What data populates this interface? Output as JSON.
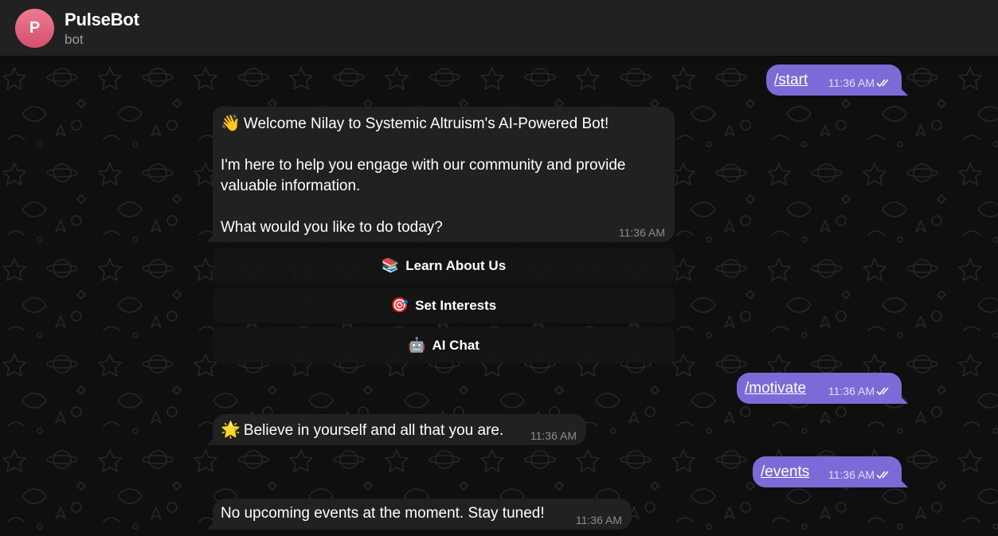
{
  "header": {
    "avatar_letter": "P",
    "title": "PulseBot",
    "subtitle": "bot",
    "avatar_color": "#e0607d"
  },
  "colors": {
    "outgoing_bubble": "#7b6bd6",
    "incoming_bubble": "#212121",
    "background": "#0f0f0f"
  },
  "messages": [
    {
      "direction": "out",
      "text": "/start",
      "time": "11:36 AM",
      "status_icon": "double-check-icon"
    },
    {
      "direction": "in",
      "emoji": "👋",
      "lines": [
        "Welcome Nilay to Systemic Altruism's AI-Powered Bot!",
        "",
        "I'm here to help you engage with our community and provide",
        "valuable information.",
        "",
        "What would you like to do today?"
      ],
      "time": "11:36 AM"
    },
    {
      "direction": "out",
      "text": "/motivate",
      "time": "11:36 AM",
      "status_icon": "double-check-icon"
    },
    {
      "direction": "in",
      "emoji": "🌟",
      "text": "Believe in yourself and all that you are.",
      "time": "11:36 AM"
    },
    {
      "direction": "out",
      "text": "/events",
      "time": "11:36 AM",
      "status_icon": "double-check-icon"
    },
    {
      "direction": "in",
      "text": "No upcoming events at the moment. Stay tuned!",
      "time": "11:36 AM"
    }
  ],
  "inline_keyboard": [
    {
      "emoji": "📚",
      "label": "Learn About Us",
      "icon": "books-icon"
    },
    {
      "emoji": "🎯",
      "label": "Set Interests",
      "icon": "target-icon"
    },
    {
      "emoji": "🤖",
      "label": "AI Chat",
      "icon": "robot-icon"
    }
  ]
}
